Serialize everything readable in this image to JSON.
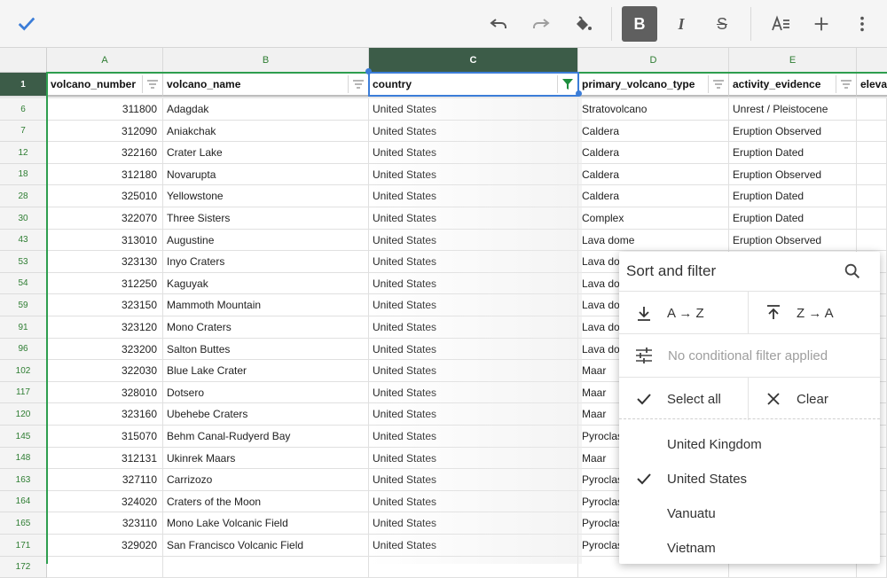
{
  "toolbar": {
    "icons": [
      "check-icon",
      "undo-icon",
      "redo-icon",
      "paint-bucket-icon",
      "bold-icon",
      "italic-icon",
      "strikethrough-icon",
      "text-align-icon",
      "insert-icon",
      "more-options-icon"
    ],
    "bold_label": "B",
    "italic_label": "I",
    "strike_label": "S"
  },
  "columns": [
    "A",
    "B",
    "C",
    "D",
    "E"
  ],
  "header_row": {
    "row_number": "1",
    "cells": [
      "volcano_number",
      "volcano_name",
      "country",
      "primary_volcano_type",
      "activity_evidence",
      "eleva"
    ]
  },
  "rows": [
    {
      "n": "6",
      "a": "311800",
      "b": "Adagdak",
      "c": "United States",
      "d": "Stratovolcano",
      "e": "Unrest / Pleistocene"
    },
    {
      "n": "7",
      "a": "312090",
      "b": "Aniakchak",
      "c": "United States",
      "d": "Caldera",
      "e": "Eruption Observed"
    },
    {
      "n": "12",
      "a": "322160",
      "b": "Crater Lake",
      "c": "United States",
      "d": "Caldera",
      "e": "Eruption Dated"
    },
    {
      "n": "18",
      "a": "312180",
      "b": "Novarupta",
      "c": "United States",
      "d": "Caldera",
      "e": "Eruption Observed"
    },
    {
      "n": "28",
      "a": "325010",
      "b": "Yellowstone",
      "c": "United States",
      "d": "Caldera",
      "e": "Eruption Dated"
    },
    {
      "n": "30",
      "a": "322070",
      "b": "Three Sisters",
      "c": "United States",
      "d": "Complex",
      "e": "Eruption Dated"
    },
    {
      "n": "43",
      "a": "313010",
      "b": "Augustine",
      "c": "United States",
      "d": "Lava dome",
      "e": "Eruption Observed"
    },
    {
      "n": "53",
      "a": "323130",
      "b": "Inyo Craters",
      "c": "United States",
      "d": "Lava do",
      "e": ""
    },
    {
      "n": "54",
      "a": "312250",
      "b": "Kaguyak",
      "c": "United States",
      "d": "Lava do",
      "e": ""
    },
    {
      "n": "59",
      "a": "323150",
      "b": "Mammoth Mountain",
      "c": "United States",
      "d": "Lava do",
      "e": ""
    },
    {
      "n": "91",
      "a": "323120",
      "b": "Mono Craters",
      "c": "United States",
      "d": "Lava do",
      "e": ""
    },
    {
      "n": "96",
      "a": "323200",
      "b": "Salton Buttes",
      "c": "United States",
      "d": "Lava do",
      "e": ""
    },
    {
      "n": "102",
      "a": "322030",
      "b": "Blue Lake Crater",
      "c": "United States",
      "d": "Maar",
      "e": ""
    },
    {
      "n": "117",
      "a": "328010",
      "b": "Dotsero",
      "c": "United States",
      "d": "Maar",
      "e": ""
    },
    {
      "n": "120",
      "a": "323160",
      "b": "Ubehebe Craters",
      "c": "United States",
      "d": "Maar",
      "e": ""
    },
    {
      "n": "145",
      "a": "315070",
      "b": "Behm Canal-Rudyerd Bay",
      "c": "United States",
      "d": "Pyroclas",
      "e": ""
    },
    {
      "n": "148",
      "a": "312131",
      "b": "Ukinrek Maars",
      "c": "United States",
      "d": "Maar",
      "e": ""
    },
    {
      "n": "163",
      "a": "327110",
      "b": "Carrizozo",
      "c": "United States",
      "d": "Pyroclas",
      "e": ""
    },
    {
      "n": "164",
      "a": "324020",
      "b": "Craters of the Moon",
      "c": "United States",
      "d": "Pyroclas",
      "e": ""
    },
    {
      "n": "165",
      "a": "323110",
      "b": "Mono Lake Volcanic Field",
      "c": "United States",
      "d": "Pyroclas",
      "e": ""
    },
    {
      "n": "171",
      "a": "329020",
      "b": "San Francisco Volcanic Field",
      "c": "United States",
      "d": "Pyroclas",
      "e": ""
    },
    {
      "n": "172",
      "a": "",
      "b": "",
      "c": "",
      "d": "",
      "e": ""
    }
  ],
  "sort_filter": {
    "title": "Sort and filter",
    "sort_asc": "A → Z",
    "sort_desc": "Z → A",
    "conditional": "No conditional filter applied",
    "select_all": "Select all",
    "clear": "Clear",
    "options": [
      {
        "label": "United Kingdom",
        "checked": false
      },
      {
        "label": "United States",
        "checked": true
      },
      {
        "label": "Vanuatu",
        "checked": false
      },
      {
        "label": "Vietnam",
        "checked": false
      }
    ]
  },
  "colors": {
    "selected_header": "#3c5c48",
    "accent_green": "#2e7d32",
    "selection_blue": "#3b7dd8",
    "active_filter": "#1e8e3e"
  }
}
